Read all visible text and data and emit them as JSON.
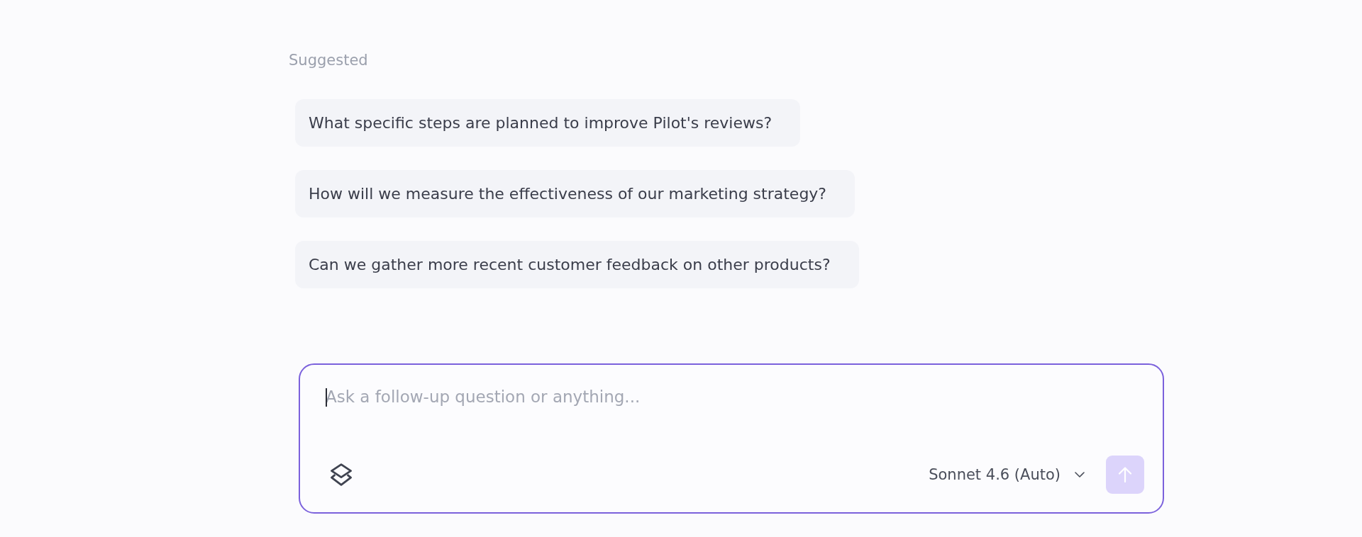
{
  "suggested": {
    "heading": "Suggested",
    "items": [
      "What specific steps are planned to improve Pilot's reviews?",
      "How will we measure the effectiveness of our marketing strategy?",
      "Can we gather more recent customer feedback on other products?"
    ]
  },
  "composer": {
    "placeholder": "Ask a follow-up question or anything...",
    "focused": true,
    "model": "Sonnet 4.6 (Auto)",
    "send_disabled": true
  }
}
